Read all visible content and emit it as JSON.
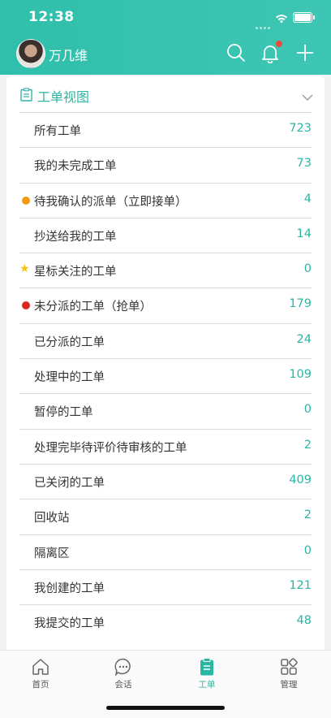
{
  "status_bar": {
    "time": "12:38"
  },
  "header": {
    "user_name": "万几维"
  },
  "card": {
    "title": "工单视图",
    "items": [
      {
        "label": "所有工单",
        "count": "723",
        "marker": ""
      },
      {
        "label": "我的未完成工单",
        "count": "73",
        "marker": ""
      },
      {
        "label": "待我确认的派单（立即接单）",
        "count": "4",
        "marker": "orange-dot"
      },
      {
        "label": "抄送给我的工单",
        "count": "14",
        "marker": ""
      },
      {
        "label": "星标关注的工单",
        "count": "0",
        "marker": "star"
      },
      {
        "label": "未分派的工单（抢单）",
        "count": "179",
        "marker": "red-dot"
      },
      {
        "label": "已分派的工单",
        "count": "24",
        "marker": ""
      },
      {
        "label": "处理中的工单",
        "count": "109",
        "marker": ""
      },
      {
        "label": "暂停的工单",
        "count": "0",
        "marker": ""
      },
      {
        "label": "处理完毕待评价待审核的工单",
        "count": "2",
        "marker": ""
      },
      {
        "label": "已关闭的工单",
        "count": "409",
        "marker": ""
      },
      {
        "label": "回收站",
        "count": "2",
        "marker": ""
      },
      {
        "label": "隔离区",
        "count": "0",
        "marker": ""
      },
      {
        "label": "我创建的工单",
        "count": "121",
        "marker": ""
      },
      {
        "label": "我提交的工单",
        "count": "48",
        "marker": ""
      }
    ]
  },
  "tabbar": {
    "tabs": [
      {
        "label": "首页",
        "icon": "home-icon",
        "active": false
      },
      {
        "label": "会话",
        "icon": "chat-icon",
        "active": false
      },
      {
        "label": "工单",
        "icon": "ticket-icon",
        "active": true
      },
      {
        "label": "管理",
        "icon": "grid-icon",
        "active": false
      }
    ]
  },
  "colors": {
    "accent": "#2bb5a3",
    "orange_dot": "#f39c12",
    "red_dot": "#d9261c",
    "star": "#f5c518"
  }
}
